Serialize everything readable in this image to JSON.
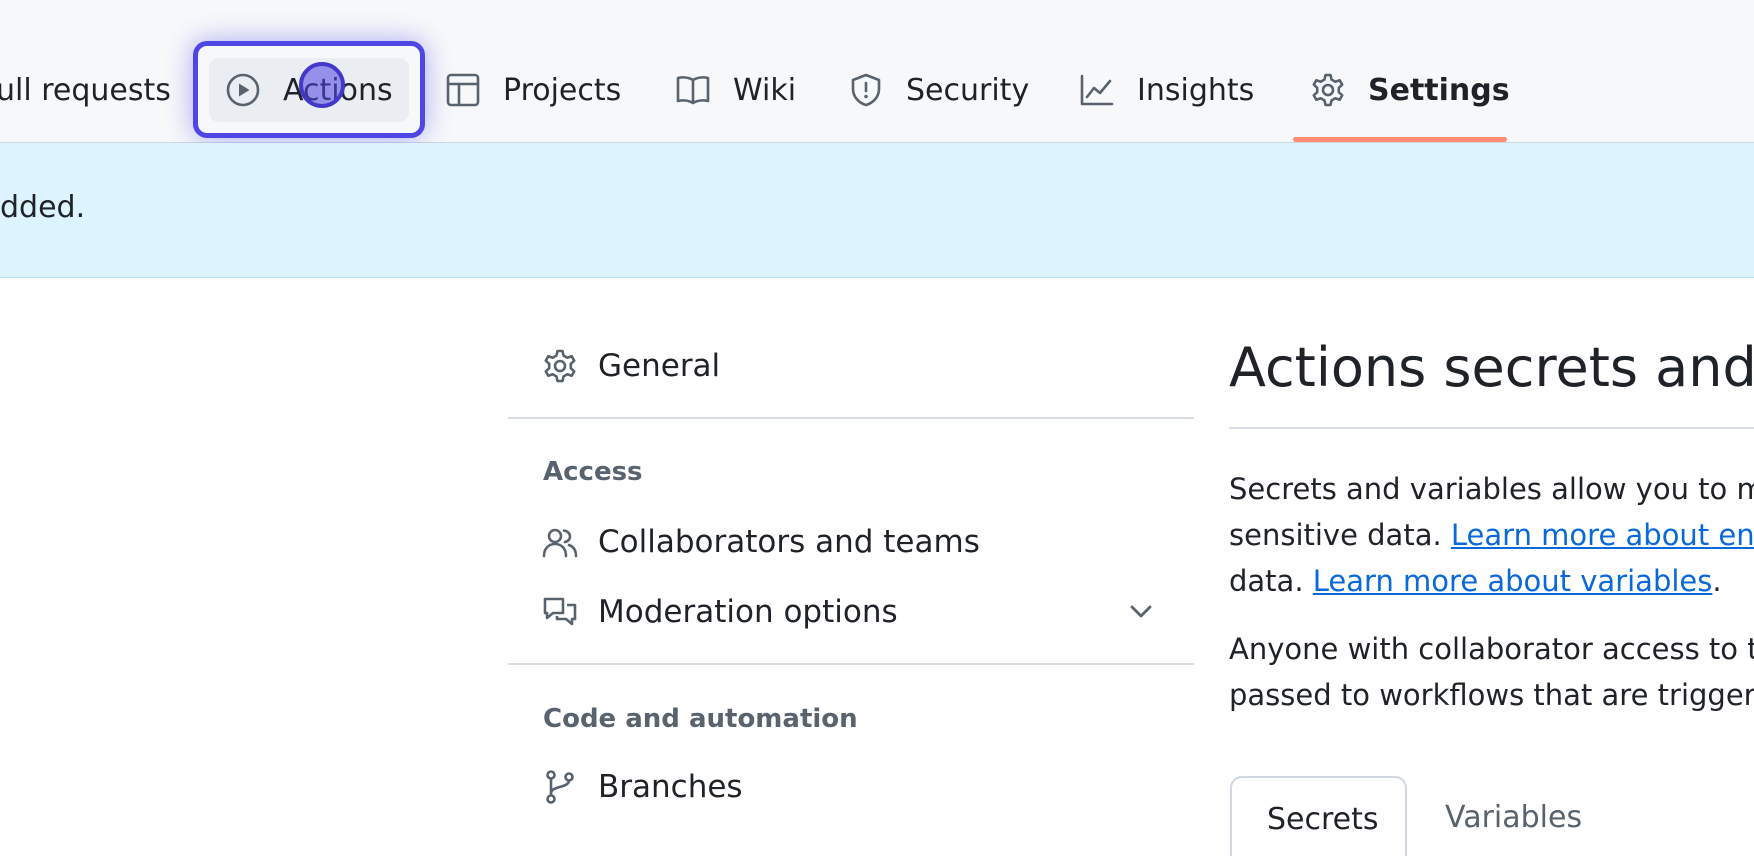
{
  "repo_nav": {
    "tabs": [
      {
        "label": "ull requests",
        "icon": "pull-request-icon"
      },
      {
        "label": "Actions",
        "icon": "play-circle-icon"
      },
      {
        "label": "Projects",
        "icon": "table-icon"
      },
      {
        "label": "Wiki",
        "icon": "book-icon"
      },
      {
        "label": "Security",
        "icon": "shield-icon"
      },
      {
        "label": "Insights",
        "icon": "graph-icon"
      },
      {
        "label": "Settings",
        "icon": "gear-icon"
      }
    ],
    "active_tab": "Settings",
    "focused_tab": "Actions"
  },
  "banner": {
    "text": "dded."
  },
  "sidebar": {
    "general": {
      "label": "General",
      "icon": "gear-icon"
    },
    "access": {
      "heading": "Access",
      "items": [
        {
          "label": "Collaborators and teams",
          "icon": "people-icon"
        },
        {
          "label": "Moderation options",
          "icon": "comment-discussion-icon",
          "expandable": true
        }
      ]
    },
    "code_automation": {
      "heading": "Code and automation",
      "items": [
        {
          "label": "Branches",
          "icon": "git-branch-icon"
        }
      ]
    }
  },
  "main": {
    "title": "Actions secrets and va",
    "para1": {
      "line1": "Secrets and variables allow you to m",
      "line2_text": "sensitive data. ",
      "line2_link": "Learn more about enc",
      "line3_text": "data. ",
      "line3_link": "Learn more about variables",
      "line3_end": "."
    },
    "para2": {
      "line1": "Anyone with collaborator access to t",
      "line2": "passed to workflows that are trigger"
    },
    "tabs": {
      "secrets": "Secrets",
      "variables": "Variables"
    }
  },
  "colors": {
    "accent": "#4f46e5",
    "active_underline": "#fd8c73",
    "banner_bg": "#ddf4ff",
    "link": "#0969da"
  }
}
